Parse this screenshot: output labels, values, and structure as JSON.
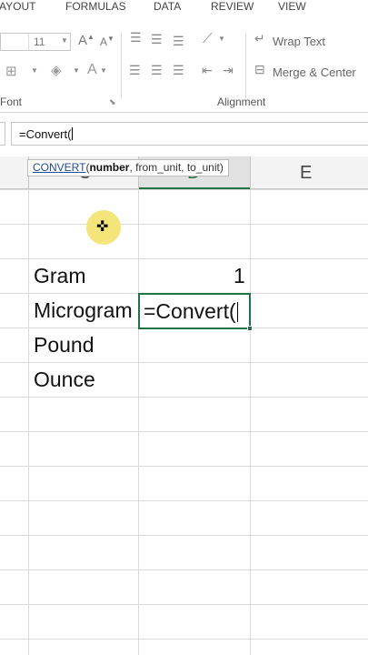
{
  "ribbon": {
    "tabs": [
      "AYOUT",
      "FORMULAS",
      "DATA",
      "REVIEW",
      "VIEW"
    ],
    "font": {
      "size_value": "11",
      "group_label": "Font",
      "grow_label": "A",
      "shrink_label": "A"
    },
    "alignment": {
      "wrap_text_label": "Wrap Text",
      "merge_center_label": "Merge & Center",
      "group_label": "Alignment"
    }
  },
  "formula_bar": {
    "value": "=Convert("
  },
  "tooltip": {
    "function_name": "CONVERT",
    "open_paren": "(",
    "bold_arg": "number",
    "rest_args": ", from_unit, to_unit)"
  },
  "columns": {
    "c": "C",
    "d": "D",
    "e": "E"
  },
  "cells": {
    "c_gram": "Gram",
    "d_gram": "1",
    "c_microgram": "Microgram",
    "d_microgram_formula": "=Convert(",
    "c_pound": "Pound",
    "c_ounce": "Ounce"
  },
  "colors": {
    "accent": "#217346",
    "cursor_highlight": "#f3e57a",
    "tooltip_link": "#1f4e9c"
  }
}
